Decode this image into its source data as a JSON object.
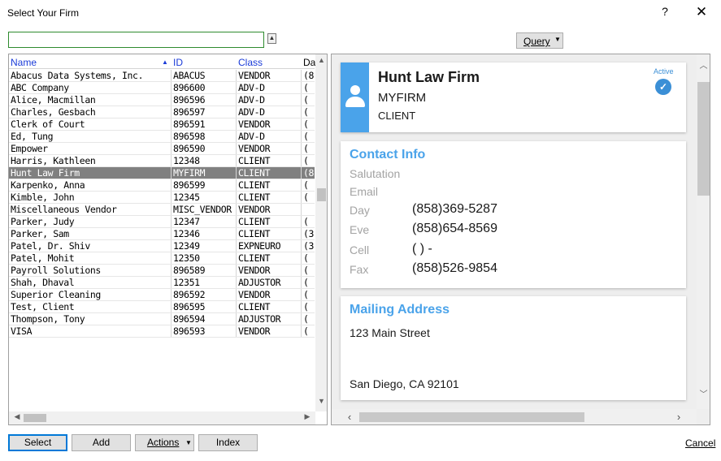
{
  "window": {
    "title": "Select Your Firm",
    "help_label": "?",
    "close_glyph": "✕"
  },
  "search": {
    "value": "",
    "placeholder": "",
    "collapse_glyph": "▲"
  },
  "query": {
    "label": "Query",
    "arrow": "▼"
  },
  "grid": {
    "columns": [
      {
        "key": "name",
        "label": "Name",
        "sorted": "asc"
      },
      {
        "key": "id",
        "label": "ID"
      },
      {
        "key": "class",
        "label": "Class"
      },
      {
        "key": "da",
        "label": "Da"
      }
    ],
    "sort_glyph": "▲",
    "rows": [
      {
        "name": "Abacus Data Systems, Inc.",
        "id": "ABACUS",
        "class": "VENDOR",
        "da": "(8"
      },
      {
        "name": "ABC Company",
        "id": "896600",
        "class": "ADV-D",
        "da": "("
      },
      {
        "name": "Alice, Macmillan",
        "id": "896596",
        "class": "ADV-D",
        "da": "("
      },
      {
        "name": "Charles, Gesbach",
        "id": "896597",
        "class": "ADV-D",
        "da": "("
      },
      {
        "name": "Clerk of Court",
        "id": "896591",
        "class": "VENDOR",
        "da": "("
      },
      {
        "name": "Ed, Tung",
        "id": "896598",
        "class": "ADV-D",
        "da": "("
      },
      {
        "name": "Empower",
        "id": "896590",
        "class": "VENDOR",
        "da": "("
      },
      {
        "name": "Harris, Kathleen",
        "id": "12348",
        "class": "CLIENT",
        "da": "("
      },
      {
        "name": "Hunt Law Firm",
        "id": "MYFIRM",
        "class": "CLIENT",
        "da": "(8",
        "selected": true
      },
      {
        "name": "Karpenko, Anna",
        "id": "896599",
        "class": "CLIENT",
        "da": "("
      },
      {
        "name": "Kimble, John",
        "id": "12345",
        "class": "CLIENT",
        "da": "("
      },
      {
        "name": "Miscellaneous Vendor",
        "id": "MISC_VENDOR",
        "class": "VENDOR",
        "da": ""
      },
      {
        "name": "Parker, Judy",
        "id": "12347",
        "class": "CLIENT",
        "da": "("
      },
      {
        "name": "Parker, Sam",
        "id": "12346",
        "class": "CLIENT",
        "da": "(3"
      },
      {
        "name": "Patel, Dr. Shiv",
        "id": "12349",
        "class": "EXPNEURO",
        "da": "(3"
      },
      {
        "name": "Patel, Mohit",
        "id": "12350",
        "class": "CLIENT",
        "da": "("
      },
      {
        "name": "Payroll Solutions",
        "id": "896589",
        "class": "VENDOR",
        "da": "("
      },
      {
        "name": "Shah, Dhaval",
        "id": "12351",
        "class": "ADJUSTOR",
        "da": "("
      },
      {
        "name": "Superior Cleaning",
        "id": "896592",
        "class": "VENDOR",
        "da": "("
      },
      {
        "name": "Test, Client",
        "id": "896595",
        "class": "CLIENT",
        "da": "("
      },
      {
        "name": "Thompson, Tony",
        "id": "896594",
        "class": "ADJUSTOR",
        "da": "("
      },
      {
        "name": "VISA",
        "id": "896593",
        "class": "VENDOR",
        "da": "("
      }
    ]
  },
  "firm_card": {
    "name": "Hunt Law Firm",
    "id": "MYFIRM",
    "class": "CLIENT",
    "status": "Active",
    "status_glyph": "✓",
    "accent_color": "#4aa3ea"
  },
  "contact": {
    "title": "Contact Info",
    "salutation_label": "Salutation",
    "salutation": "",
    "email_label": "Email",
    "email": "",
    "day_label": "Day",
    "day": "(858)369-5287",
    "eve_label": "Eve",
    "eve": "(858)654-8569",
    "cell_label": "Cell",
    "cell": "( ) -",
    "fax_label": "Fax",
    "fax": "(858)526-9854"
  },
  "mailing": {
    "title": "Mailing Address",
    "line1": "123 Main Street",
    "city_line": "San Diego, CA 92101"
  },
  "buttons": {
    "select": "Select",
    "add": "Add",
    "actions": "Actions",
    "actions_arrow": "▼",
    "index": "Index",
    "cancel": "Cancel"
  },
  "scroll_glyphs": {
    "up": "▲",
    "down": "▼",
    "left": "◀",
    "right": "▶",
    "p_up": "︿",
    "p_down": "﹀",
    "p_left": "‹",
    "p_right": "›"
  }
}
